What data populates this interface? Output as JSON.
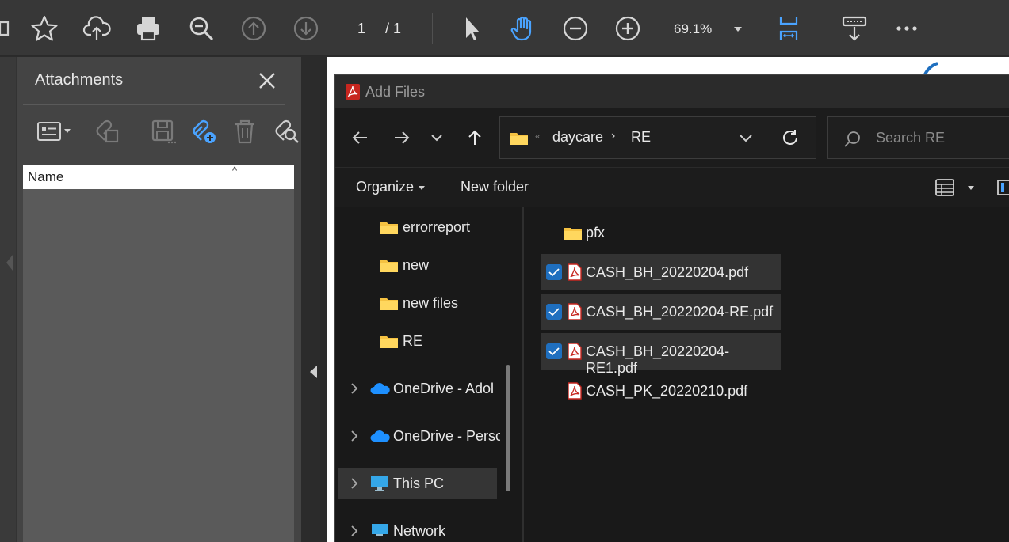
{
  "toolbar": {
    "page_current": "1",
    "page_total": "/ 1",
    "zoom": "69.1%",
    "icons": [
      "star-icon",
      "cloud-upload-icon",
      "print-icon",
      "zoom-search-icon",
      "page-up-icon",
      "page-down-icon",
      "select-cursor-icon",
      "hand-tool-icon",
      "zoom-out-icon",
      "zoom-in-icon",
      "fit-page-icon",
      "scroll-mode-icon",
      "more-icon"
    ],
    "accent": "#4aa3ff"
  },
  "attachments": {
    "title": "Attachments",
    "column_name": "Name",
    "sort_indicator": "^",
    "tool_icons": [
      "options-list-icon",
      "open-attachment-icon",
      "save-attachment-icon",
      "add-attachment-icon",
      "delete-attachment-icon",
      "search-attachment-icon"
    ]
  },
  "dialog": {
    "title": "Add Files",
    "address": {
      "overflow": "«",
      "segment1": "daycare",
      "separator": "›",
      "segment2": "RE"
    },
    "search_placeholder": "Search RE",
    "commands": {
      "organize": "Organize",
      "new_folder": "New folder"
    },
    "tree": [
      {
        "label": "errorreport",
        "type": "folder"
      },
      {
        "label": "new",
        "type": "folder"
      },
      {
        "label": "new files",
        "type": "folder"
      },
      {
        "label": "RE",
        "type": "folder"
      },
      {
        "label": "OneDrive - Adol",
        "type": "onedrive"
      },
      {
        "label": "OneDrive - Perso",
        "type": "onedrive"
      },
      {
        "label": "This PC",
        "type": "pc"
      },
      {
        "label": "Network",
        "type": "network"
      }
    ],
    "files": [
      {
        "name": "pfx",
        "type": "folder",
        "selected": false
      },
      {
        "name": "CASH_BH_20220204.pdf",
        "type": "pdf",
        "selected": true
      },
      {
        "name": "CASH_BH_20220204-RE.pdf",
        "type": "pdf",
        "selected": true
      },
      {
        "name": "CASH_BH_20220204-RE1.pdf",
        "type": "pdf",
        "selected": true
      },
      {
        "name": "CASH_PK_20220210.pdf",
        "type": "pdf",
        "selected": false
      }
    ]
  }
}
